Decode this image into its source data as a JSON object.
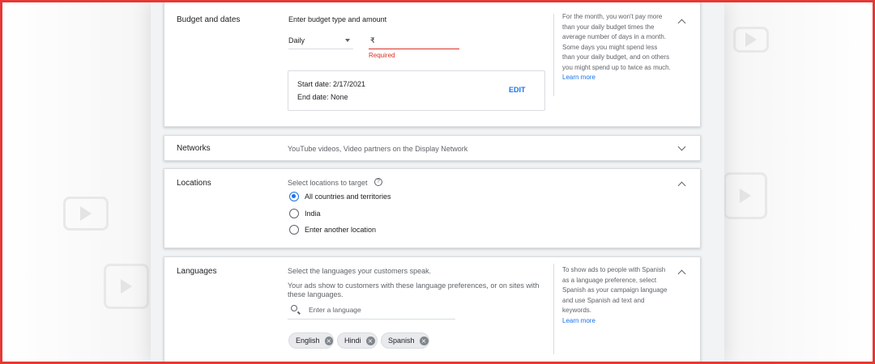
{
  "budget": {
    "title": "Budget and dates",
    "label": "Enter budget type and amount",
    "type_value": "Daily",
    "currency_symbol": "₹",
    "error": "Required",
    "start_date": "Start date: 2/17/2021",
    "end_date": "End date: None",
    "edit_label": "EDIT",
    "help_text": "For the month, you won't pay more than your daily budget times the average number of days in a month. Some days you might spend less than your daily budget, and on others you might spend up to twice as much.",
    "learn_more": "Learn more"
  },
  "networks": {
    "title": "Networks",
    "summary": "YouTube videos, Video partners on the Display Network"
  },
  "locations": {
    "title": "Locations",
    "label": "Select locations to target",
    "options": [
      {
        "label": "All countries and territories",
        "selected": true
      },
      {
        "label": "India",
        "selected": false
      },
      {
        "label": "Enter another location",
        "selected": false
      }
    ]
  },
  "languages": {
    "title": "Languages",
    "label": "Select the languages your customers speak.",
    "description": "Your ads show to customers with these language preferences, or on sites with these languages.",
    "search_placeholder": "Enter a language",
    "chips": [
      "English",
      "Hindi",
      "Spanish"
    ],
    "help_text": "To show ads to people with Spanish as a language preference, select Spanish as your campaign language and use Spanish ad text and keywords.",
    "learn_more": "Learn more"
  },
  "colors": {
    "accent": "#1a73e8",
    "error": "#d93025",
    "frame": "#e53935"
  }
}
